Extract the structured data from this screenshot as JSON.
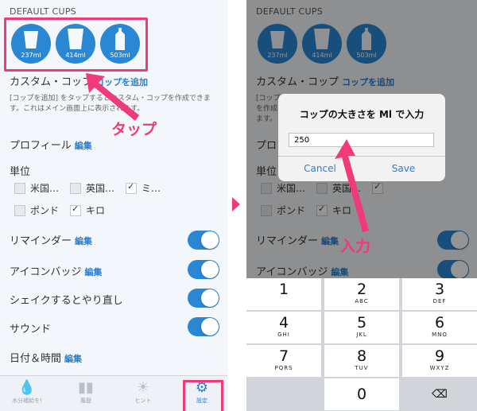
{
  "left": {
    "default_cups_label": "DEFAULT CUPS",
    "cups": [
      "237ml",
      "414ml",
      "503ml"
    ],
    "custom_cup": {
      "title": "カスタム・コップ",
      "link": "コップを追加"
    },
    "description": "[コップを追加] をタップするとカスタム・コップを作成できます。これはメイン画面上に表示されます。",
    "profile": {
      "title": "プロフィール",
      "link": "編集"
    },
    "units": {
      "title": "単位",
      "items": [
        {
          "label": "米国…",
          "checked": false
        },
        {
          "label": "英国…",
          "checked": false
        },
        {
          "label": "ミ…",
          "checked": true
        },
        {
          "label": "ポンド",
          "checked": false
        },
        {
          "label": "キロ",
          "checked": true
        }
      ]
    },
    "reminder": {
      "title": "リマインダー",
      "link": "編集"
    },
    "icon_badge": {
      "title": "アイコンバッジ",
      "link": "編集"
    },
    "shake": {
      "title": "シェイクするとやり直し"
    },
    "sound": {
      "title": "サウンド"
    },
    "datetime": {
      "title": "日付＆時間",
      "link": "編集"
    },
    "tabs": [
      "水分補給を!",
      "履歴",
      "ヒント",
      "設定"
    ],
    "annotation_tap": "タップ"
  },
  "right": {
    "default_cups_label": "DEFAULT CUPS",
    "cups": [
      "237ml",
      "414ml",
      "503ml"
    ],
    "custom_cup": {
      "title": "カスタム・コップ",
      "link": "コップを追加"
    },
    "description_partial": "[コップ\nを作成\nます。",
    "profile_partial": "プロフ",
    "units_partial": "単位",
    "unit_labels": [
      "米国…",
      "英国…",
      "ポンド",
      "キロ"
    ],
    "reminder": {
      "title": "リマインダー",
      "link": "編集"
    },
    "icon_badge": {
      "title": "アイコンバッジ",
      "link": "編集"
    },
    "dialog": {
      "title": "コップの大きさを Ml で入力",
      "value": "250",
      "cancel": "Cancel",
      "save": "Save"
    },
    "keys": [
      {
        "n": "1",
        "l": ""
      },
      {
        "n": "2",
        "l": "ABC"
      },
      {
        "n": "3",
        "l": "DEF"
      },
      {
        "n": "4",
        "l": "GHI"
      },
      {
        "n": "5",
        "l": "JKL"
      },
      {
        "n": "6",
        "l": "MNO"
      },
      {
        "n": "7",
        "l": "PQRS"
      },
      {
        "n": "8",
        "l": "TUV"
      },
      {
        "n": "9",
        "l": "WXYZ"
      },
      {
        "n": "0",
        "l": ""
      }
    ],
    "annotation_input": "入力"
  },
  "colors": {
    "accent": "#2a87d4",
    "annotation": "#f03a7a"
  }
}
